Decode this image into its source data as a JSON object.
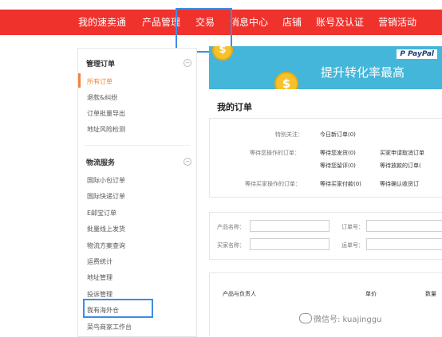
{
  "topnav": {
    "items": [
      "我的速卖通",
      "产品管理",
      "交易",
      "消息中心",
      "店铺",
      "账号及认证",
      "营销活动"
    ],
    "highlighted": "交易"
  },
  "sidebar": {
    "sections": [
      {
        "heading": "管理订单",
        "toggle": "−",
        "items": [
          "所有订单",
          "退款&纠纷",
          "订单批量导出",
          "地址风险检测"
        ],
        "active": "所有订单"
      },
      {
        "heading": "物流服务",
        "toggle": "−",
        "items": [
          "国际小包订单",
          "国际快递订单",
          "E邮宝订单",
          "批量线上发货",
          "物流方案查询",
          "运费统计",
          "地址管理",
          "投诉管理",
          "我有海外仓",
          "菜鸟商家工作台"
        ],
        "highlighted": "我有海外仓"
      }
    ]
  },
  "banner": {
    "brand": "P PayPal",
    "headline": "提升转化率最高",
    "coin_symbol": "$"
  },
  "page_title": "我的订单",
  "order_status": {
    "rows": [
      {
        "label": "特别关注：",
        "values": [
          "今日新订单(0)"
        ]
      },
      {
        "label": "等待您操作的订单：",
        "values": [
          "等待您发货(0)",
          "买家申请取消订单",
          "等待您留评(0)",
          "等待放款的订单("
        ]
      },
      {
        "label": "等待买家操作的订单：",
        "values": [
          "等待买家付款(0)",
          "等待确认收货订"
        ]
      }
    ]
  },
  "search": {
    "fields": [
      {
        "label": "产品名称："
      },
      {
        "label": "订单号："
      },
      {
        "label": "买家名称："
      },
      {
        "label": "运单号："
      }
    ]
  },
  "table": {
    "headers": [
      "产品与负责人",
      "单价",
      "数量"
    ]
  },
  "watermark": "微信号: kuajinggu",
  "colors": {
    "nav_bg": "#f0322d",
    "highlight_box": "#3a8ee6",
    "active_bar": "#f2833c",
    "banner_bg": "#43b6d9"
  }
}
